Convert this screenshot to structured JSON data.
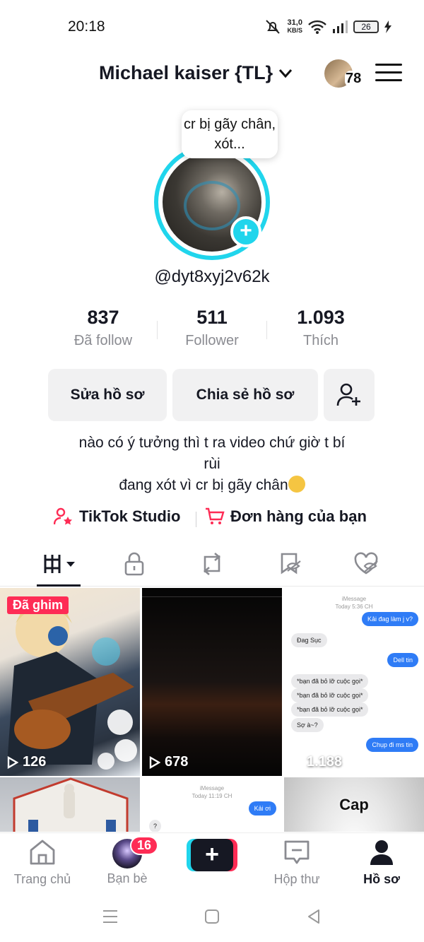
{
  "status_bar": {
    "time": "20:18",
    "net_speed_value": "31,0",
    "net_speed_unit": "KB/S",
    "battery": "26"
  },
  "header": {
    "title": "Michael kaiser {TL}",
    "avatar_count": "78"
  },
  "profile": {
    "note": "cr bị gãy chân, xót...",
    "handle": "@dyt8xyj2v62k",
    "stats": [
      {
        "value": "837",
        "label": "Đã follow"
      },
      {
        "value": "511",
        "label": "Follower"
      },
      {
        "value": "1.093",
        "label": "Thích"
      }
    ],
    "edit_button": "Sửa hồ sơ",
    "share_button": "Chia sẻ hồ sơ",
    "bio_line1": "nào có ý tưởng thì t ra video chứ giờ t bí",
    "bio_line2": "rùi",
    "bio_line3": "đang xót vì cr bị gãy chân",
    "link_studio": "TikTok Studio",
    "link_orders": "Đơn hàng của bạn"
  },
  "tabs": [
    "videos-tab",
    "private-tab",
    "reposts-tab",
    "saved-tab",
    "liked-tab"
  ],
  "videos": [
    {
      "pinned_label": "Đã ghim",
      "views": "126"
    },
    {
      "views": "678"
    },
    {
      "views": "1.188",
      "chat": {
        "header": "iMessage",
        "sub": "Today 5:36 CH",
        "messages": [
          "Kải đag làm j v?",
          "Đag Sục",
          "Dell tin",
          "*bạn đã bỏ lỡ cuộc gọi*",
          "*bạn đã bỏ lỡ cuộc gọi*",
          "*bạn đã bỏ lỡ cuộc gọi*",
          "Sợ à~?",
          "Chụp đi ms tin"
        ]
      }
    },
    {},
    {
      "chat": {
        "header": "iMessage",
        "sub": "Today 11:19 CH",
        "messages": [
          "Kải ơi",
          "?"
        ]
      }
    },
    {
      "caption": "Cap"
    }
  ],
  "bottom_nav": [
    {
      "label": "Trang chủ"
    },
    {
      "label": "Bạn bè",
      "badge": "16"
    },
    {
      "label": ""
    },
    {
      "label": "Hộp thư"
    },
    {
      "label": "Hồ sơ"
    }
  ],
  "colors": {
    "accent_pink": "#fe2c55",
    "accent_cyan": "#20d5ec",
    "text": "#161823",
    "muted": "#8a8b91"
  }
}
